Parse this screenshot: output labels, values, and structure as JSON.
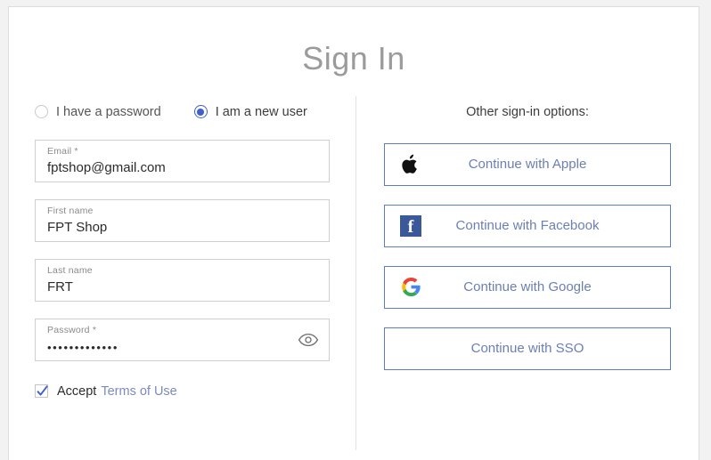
{
  "page": {
    "title": "Sign In"
  },
  "account_type": {
    "options": [
      {
        "label": "I have a password",
        "selected": false,
        "name": "existing-user"
      },
      {
        "label": "I am a new user",
        "selected": true,
        "name": "new-user"
      }
    ]
  },
  "form": {
    "email": {
      "label": "Email *",
      "value": "fptshop@gmail.com",
      "placeholder": "Email *"
    },
    "first_name": {
      "label": "First name",
      "value": "FPT Shop",
      "placeholder": "First name"
    },
    "last_name": {
      "label": "Last name",
      "value": "FRT",
      "placeholder": "Last name"
    },
    "password": {
      "label": "Password *",
      "value": "•••••••••••••",
      "placeholder": "Password *",
      "toggle_icon": "eye-icon"
    },
    "accept": {
      "checked": true,
      "text": "Accept",
      "link_text": "Terms of Use"
    }
  },
  "other_options": {
    "heading": "Other sign-in options:",
    "buttons": [
      {
        "label": "Continue with Apple",
        "icon": "apple-icon"
      },
      {
        "label": "Continue with Facebook",
        "icon": "facebook-icon"
      },
      {
        "label": "Continue with Google",
        "icon": "google-icon"
      },
      {
        "label": "Continue with SSO",
        "icon": "none"
      }
    ]
  },
  "colors": {
    "accent_blue": "#3f5fd0",
    "link_blue": "#7b8bbd",
    "button_border": "#5b7fc0",
    "facebook_blue": "#3b5998",
    "title_gray": "#9b9b9b"
  }
}
